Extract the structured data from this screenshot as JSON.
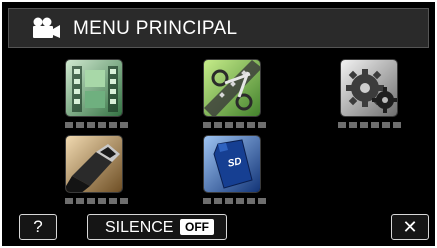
{
  "header": {
    "title": "MENU PRINCIPAL",
    "icon": "video-camera-icon"
  },
  "menu_items": [
    {
      "icon": "film-strip-icon",
      "label_placeholder": "▬▬▬▬▬▬▬"
    },
    {
      "icon": "film-edit-scissors-icon",
      "label_placeholder": "▬▬▬▬▬▬▬"
    },
    {
      "icon": "settings-gears-icon",
      "label_placeholder": "▬▬▬▬▬▬▬"
    },
    {
      "icon": "hdmi-connector-icon",
      "label_placeholder": "▬▬▬▬▬▬▬"
    },
    {
      "icon": "sd-card-icon",
      "label_placeholder": "▬▬▬▬▬▬▬"
    }
  ],
  "footer": {
    "help_label": "?",
    "silence_label": "SILENCE",
    "silence_state": "OFF",
    "close_label": "✕"
  },
  "colors": {
    "background": "#000000",
    "border": "#ffffff",
    "header_bg": "#2a2a2a",
    "placeholder_bar": "#6e6e6e",
    "film_green": "#7fbf7f",
    "scissors_green": "#8fcf60",
    "gear_grey": "#9a9a9a",
    "sd_blue": "#1c4fa8"
  }
}
